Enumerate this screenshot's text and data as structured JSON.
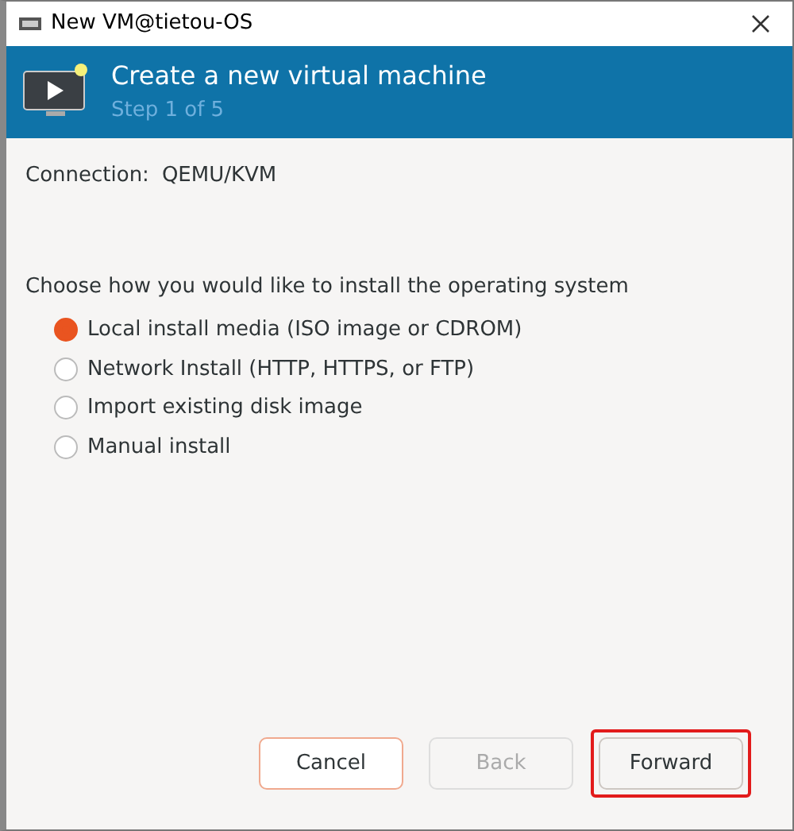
{
  "window": {
    "title": "New VM@tietou-OS"
  },
  "header": {
    "title": "Create a new virtual machine",
    "subtitle": "Step 1 of 5"
  },
  "connection": {
    "label": "Connection:",
    "value": "QEMU/KVM"
  },
  "prompt": "Choose how you would like to install the operating system",
  "options": [
    {
      "label": "Local install media (ISO image or CDROM)",
      "selected": true
    },
    {
      "label": "Network Install (HTTP, HTTPS, or FTP)",
      "selected": false
    },
    {
      "label": "Import existing disk image",
      "selected": false
    },
    {
      "label": "Manual install",
      "selected": false
    }
  ],
  "buttons": [
    {
      "label": "Cancel",
      "kind": "cancel",
      "disabled": false,
      "highlighted": false
    },
    {
      "label": "Back",
      "kind": "normal",
      "disabled": true,
      "highlighted": false
    },
    {
      "label": "Forward",
      "kind": "normal",
      "disabled": false,
      "highlighted": true
    }
  ]
}
